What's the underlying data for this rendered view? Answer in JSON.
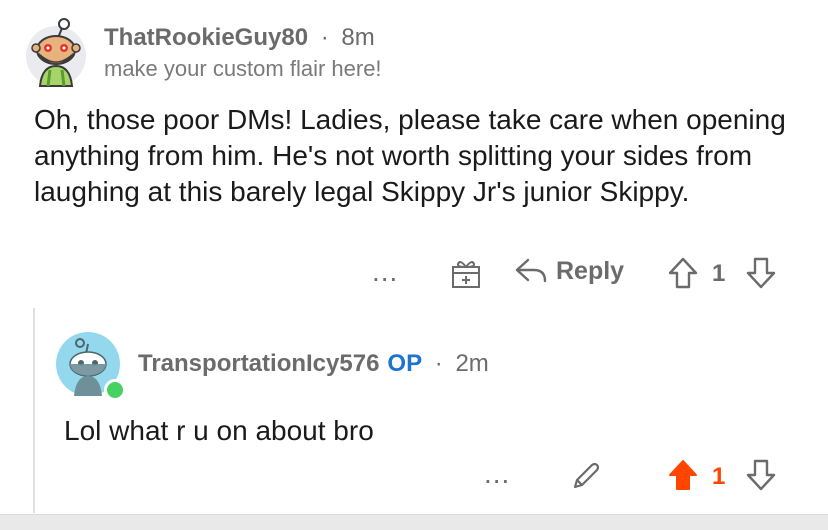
{
  "comment": {
    "author": "ThatRookieGuy80",
    "separator": "·",
    "time": "8m",
    "flair": "make your custom flair here!",
    "body": "Oh, those poor DMs! Ladies, please take care when opening anything from him. He's not worth splitting your sides from laughing at this barely legal Skippy Jr's junior Skippy.",
    "more_label": "...",
    "reply_label": "Reply",
    "vote_count": "1",
    "icons": [
      "snoo-avatar",
      "more-icon",
      "gift-award-icon",
      "reply-icon",
      "upvote-icon",
      "downvote-icon"
    ]
  },
  "reply": {
    "author": "TransportationIcy576",
    "op_badge": "OP",
    "separator": "·",
    "time": "2m",
    "body": "Lol what r u on about bro",
    "more_label": "...",
    "vote_count": "1",
    "upvoted": true,
    "online": true,
    "icons": [
      "snoo-avatar",
      "online-dot",
      "more-icon",
      "edit-icon",
      "upvote-filled-icon",
      "downvote-icon"
    ]
  },
  "colors": {
    "upvote_active": "#ff4500",
    "op_badge": "#1b74d0",
    "online": "#46d160",
    "avatar2_bg": "#94d8ee",
    "meta_text": "#6b6b6b"
  }
}
